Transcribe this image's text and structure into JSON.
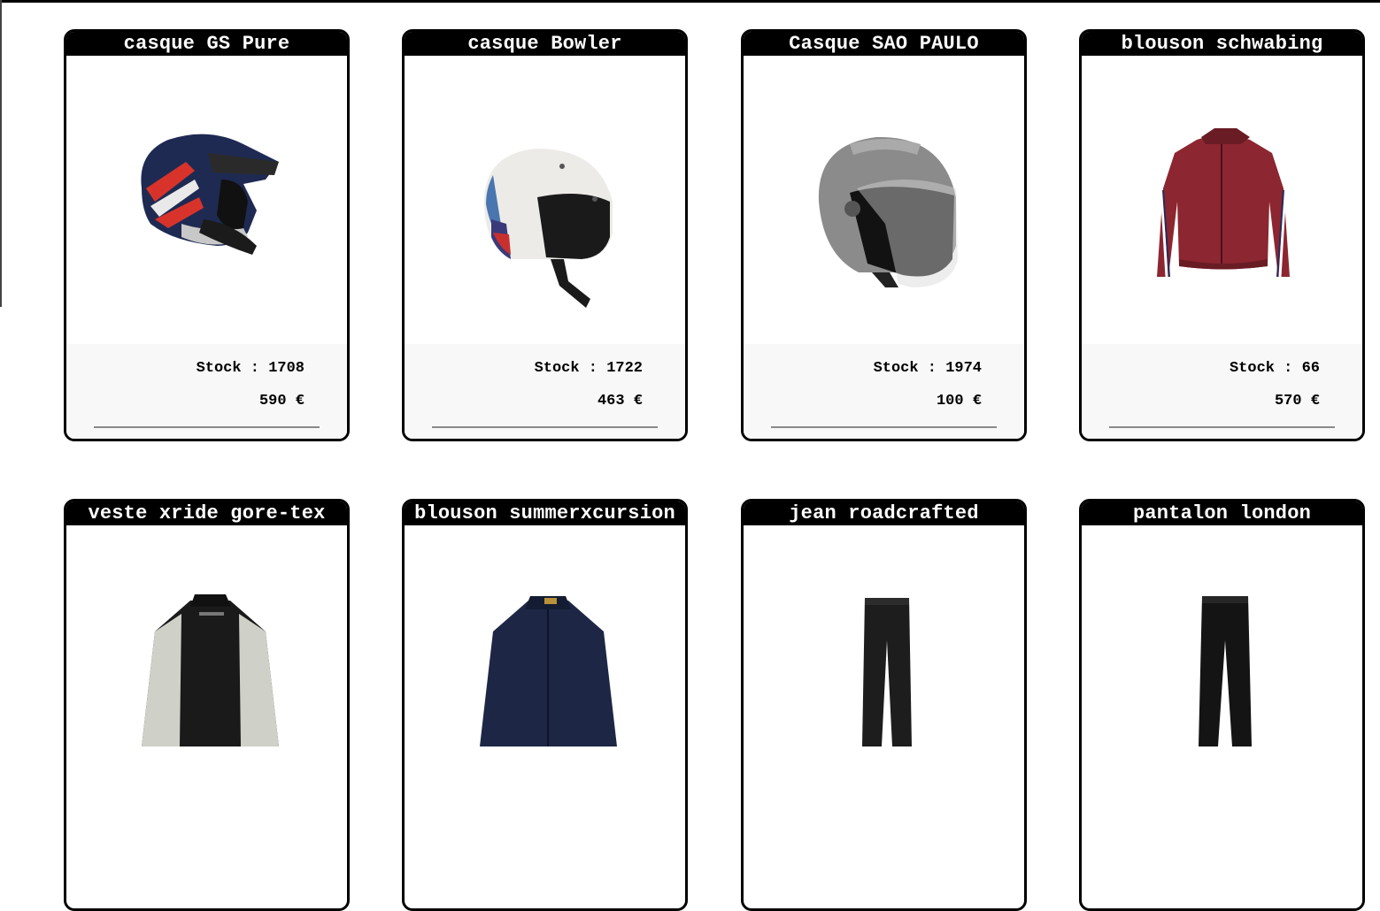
{
  "products": [
    {
      "name": "casque GS Pure",
      "stock_label": "Stock :",
      "stock": "1708",
      "price": "590",
      "currency": "€",
      "icon": "adventure-helmet-icon"
    },
    {
      "name": "casque Bowler",
      "stock_label": "Stock :",
      "stock": "1722",
      "price": "463",
      "currency": "€",
      "icon": "open-face-helmet-icon"
    },
    {
      "name": "Casque SAO PAULO",
      "stock_label": "Stock :",
      "stock": "1974",
      "price": "100",
      "currency": "€",
      "icon": "jet-helmet-icon"
    },
    {
      "name": "blouson schwabing",
      "stock_label": "Stock :",
      "stock": "66",
      "price": "570",
      "currency": "€",
      "icon": "leather-jacket-icon"
    },
    {
      "name": "veste xride gore-tex",
      "icon": "textile-jacket-icon"
    },
    {
      "name": "blouson summerxcursion",
      "icon": "mesh-jacket-icon"
    },
    {
      "name": "jean roadcrafted",
      "icon": "jeans-icon"
    },
    {
      "name": "pantalon london",
      "icon": "trousers-icon"
    }
  ]
}
